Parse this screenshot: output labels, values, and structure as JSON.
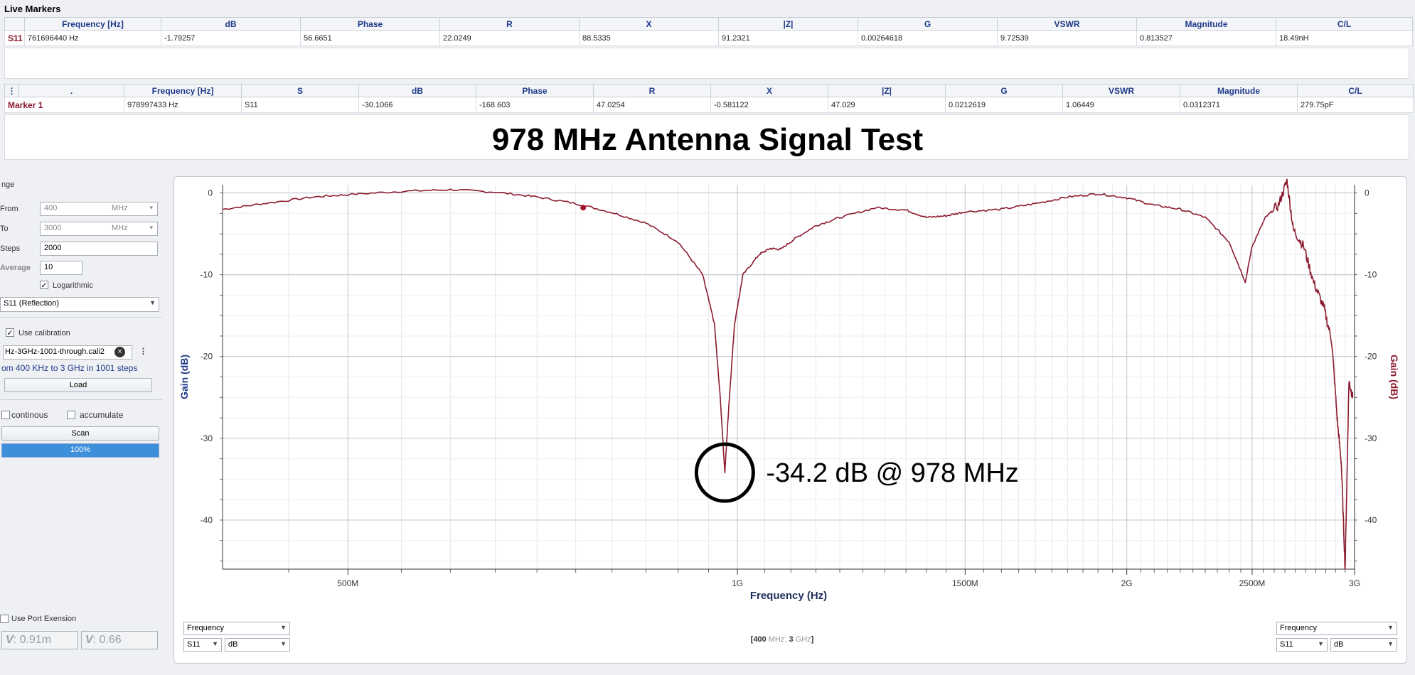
{
  "live_markers": {
    "title": "Live Markers",
    "headers": [
      "",
      "Frequency [Hz]",
      "dB",
      "Phase",
      "R",
      "X",
      "|Z|",
      "G",
      "VSWR",
      "Magnitude",
      "C/L"
    ],
    "row": [
      "S11",
      "761696440 Hz",
      "-1.79257",
      "56.6651",
      "22.0249",
      "88.5335",
      "91.2321",
      "0.00264618",
      "9.72539",
      "0.813527",
      "18.49nH"
    ]
  },
  "markers": {
    "headers": [
      "⋮",
      ".",
      "Frequency [Hz]",
      "S",
      "dB",
      "Phase",
      "R",
      "X",
      "|Z|",
      "G",
      "VSWR",
      "Magnitude",
      "C/L"
    ],
    "row": [
      "Marker 1",
      "978997433 Hz",
      "S11",
      "-30.1066",
      "-168.603",
      "47.0254",
      "-0.581122",
      "47.029",
      "0.0212619",
      "1.06449",
      "0.0312371",
      "279.75pF"
    ]
  },
  "overlay_title": "978 MHz Antenna Signal Test",
  "sidebar": {
    "range_label": "nge",
    "from_label": "From",
    "from_value": "400",
    "from_unit": "MHz",
    "to_label": "To",
    "to_value": "3000",
    "to_unit": "MHz",
    "steps_label": "Steps",
    "steps_value": "2000",
    "average_label": "Average",
    "average_value": "10",
    "log_label": "Logarithmic",
    "mode_value": "S11 (Reflection)",
    "calib_label": "Use calibration",
    "calib_file": "Hz-3GHz-1001-through.cali2",
    "calib_info": "om 400 KHz to 3 GHz in 1001 steps",
    "load_label": "Load",
    "continuous_label": "continous",
    "accumulate_label": "accumulate",
    "scan_label": "Scan",
    "progress_label": "100%",
    "progress": 1.0,
    "port_ext_label": "Use Port Exension",
    "vf1_label": "V",
    "vf1_value": ": 0.91m",
    "vf2_label": "V",
    "vf2_value": ": 0.66"
  },
  "chart_data": {
    "type": "line",
    "xlabel": "Frequency (Hz)",
    "ylabel": "Gain (dB)",
    "ylabel_right": "Gain (dB)",
    "xscale": "log",
    "xlim": [
      400,
      3000
    ],
    "ylim": [
      -46,
      1
    ],
    "yticks": [
      0,
      -10,
      -20,
      -30,
      -40
    ],
    "xtick_labels": [
      {
        "x": 500,
        "label": "500M"
      },
      {
        "x": 1000,
        "label": "1G"
      },
      {
        "x": 1500,
        "label": "1500M"
      },
      {
        "x": 2000,
        "label": "2G"
      },
      {
        "x": 2500,
        "label": "2500M"
      },
      {
        "x": 3000,
        "label": "3G"
      }
    ],
    "series": [
      {
        "color": "#8b1a2e",
        "points": [
          [
            400,
            -2
          ],
          [
            430,
            -1.3
          ],
          [
            470,
            -0.5
          ],
          [
            500,
            -0.2
          ],
          [
            550,
            0.2
          ],
          [
            600,
            0.4
          ],
          [
            650,
            0.1
          ],
          [
            700,
            -0.5
          ],
          [
            750,
            -1.3
          ],
          [
            800,
            -2.4
          ],
          [
            850,
            -3.7
          ],
          [
            900,
            -6
          ],
          [
            940,
            -10
          ],
          [
            960,
            -16
          ],
          [
            970,
            -25
          ],
          [
            978,
            -34.2
          ],
          [
            985,
            -26
          ],
          [
            995,
            -16
          ],
          [
            1010,
            -10
          ],
          [
            1040,
            -7.5
          ],
          [
            1060,
            -6.8
          ],
          [
            1080,
            -6.9
          ],
          [
            1110,
            -5.5
          ],
          [
            1150,
            -4
          ],
          [
            1200,
            -3
          ],
          [
            1280,
            -1.8
          ],
          [
            1350,
            -2.1
          ],
          [
            1400,
            -3
          ],
          [
            1450,
            -2.8
          ],
          [
            1500,
            -2.3
          ],
          [
            1600,
            -2
          ],
          [
            1700,
            -1.3
          ],
          [
            1800,
            -0.5
          ],
          [
            1900,
            -0.1
          ],
          [
            2000,
            -0.6
          ],
          [
            2100,
            -1.5
          ],
          [
            2200,
            -2
          ],
          [
            2300,
            -3
          ],
          [
            2400,
            -6
          ],
          [
            2470,
            -10.9
          ],
          [
            2500,
            -6.5
          ],
          [
            2560,
            -3
          ],
          [
            2620,
            -1.5
          ],
          [
            2660,
            1.5
          ],
          [
            2690,
            -4.5
          ],
          [
            2740,
            -6.5
          ],
          [
            2790,
            -11
          ],
          [
            2840,
            -14
          ],
          [
            2880,
            -18
          ],
          [
            2910,
            -28
          ],
          [
            2930,
            -33
          ],
          [
            2950,
            -46
          ],
          [
            2970,
            -23
          ],
          [
            2990,
            -25
          ]
        ]
      }
    ],
    "marker": {
      "x": 760,
      "y": -1.8
    },
    "annotation": {
      "x": 978,
      "y": -34.2,
      "text": "-34.2 dB @ 978 MHz"
    },
    "footer_left": {
      "axis": "Frequency",
      "param": "S11",
      "unit": "dB"
    },
    "footer_center_pre": "[400",
    "footer_center_u1": " MHz; ",
    "footer_center_v2": "3",
    "footer_center_u2": " GHz",
    "footer_center_post": "]",
    "footer_right": {
      "axis": "Frequency",
      "param": "S11",
      "unit": "dB"
    }
  }
}
